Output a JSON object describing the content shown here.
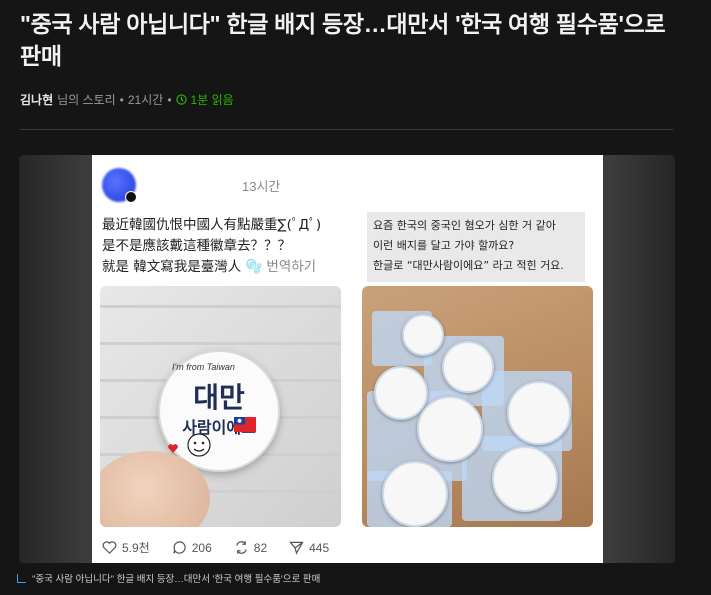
{
  "article": {
    "title": "\"중국 사람 아닙니다\" 한글 배지 등장…대만서 '한국 여행 필수품'으로 판매",
    "author": "김나현",
    "author_suffix": "님의 스토리",
    "time": "21시간",
    "read_time": "1분 읽음",
    "accent_color": "#2db400"
  },
  "post": {
    "time": "13시간",
    "cn_lines": [
      "最近韓國仇恨中國人有點嚴重∑(ﾟДﾟ)",
      "是不是應該戴這種徽章去？？？",
      "就是 韓文寫我是臺灣人"
    ],
    "flag_emoji": "🫧",
    "translate_label": "번역하기",
    "ko_lines": [
      "요즘 한국의 중국인 혐오가 심한 거 같아",
      "이런 배지를 달고 가야 할까요?",
      "한글로 “대만사람이에요” 라고 적힌 거요."
    ],
    "badge": {
      "small": "I'm from Taiwan",
      "line1": "대만",
      "line2": "사람이에요"
    },
    "stats": {
      "likes": "5.9천",
      "comments": "206",
      "reposts": "82",
      "shares": "445"
    }
  },
  "caption": "\"중국 사람 아닙니다\" 한글 배지 등장…대만서 '한국 여행 필수품'으로 판매"
}
